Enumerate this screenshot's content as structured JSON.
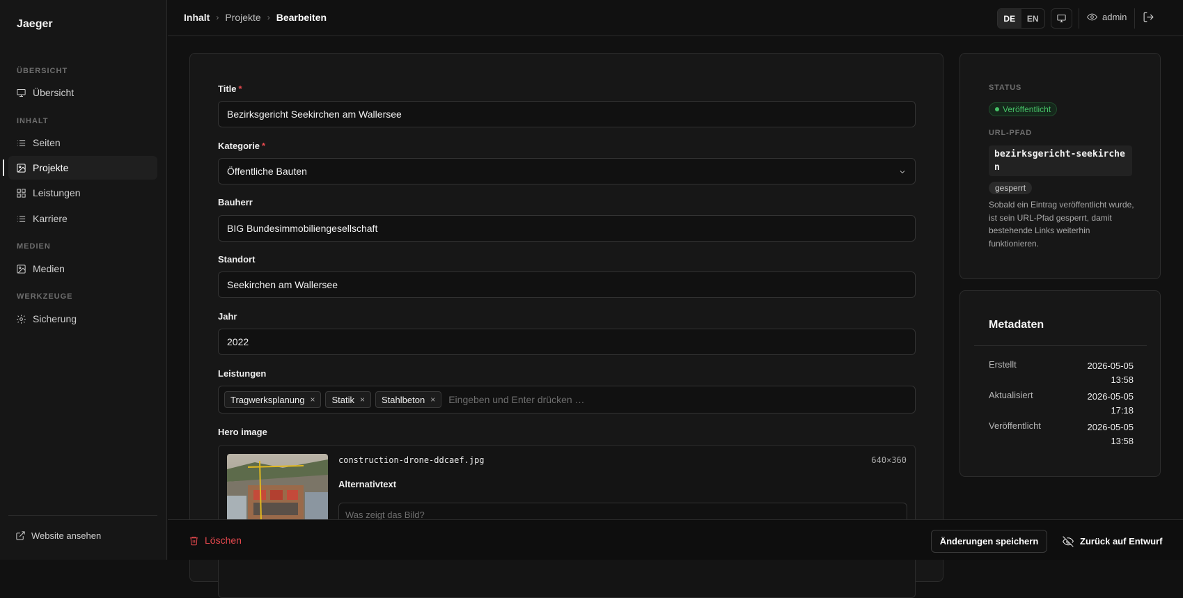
{
  "app": {
    "brand": "Jaeger"
  },
  "sidebar": {
    "sections": [
      {
        "title": "ÜBERSICHT"
      },
      {
        "title": "INHALT"
      },
      {
        "title": "MEDIEN"
      },
      {
        "title": "WERKZEUGE"
      }
    ],
    "items": [
      {
        "label": "Übersicht",
        "icon": "monitor-icon"
      },
      {
        "label": "Seiten",
        "icon": "list-icon"
      },
      {
        "label": "Projekte",
        "icon": "image-icon",
        "active": true
      },
      {
        "label": "Leistungen",
        "icon": "grid-icon"
      },
      {
        "label": "Karriere",
        "icon": "list-icon"
      },
      {
        "label": "Medien",
        "icon": "image-icon"
      },
      {
        "label": "Sicherung",
        "icon": "gear-icon"
      }
    ],
    "external_link": "Website ansehen"
  },
  "topbar": {
    "breadcrumb": [
      "Inhalt",
      "Projekte",
      "Bearbeiten"
    ],
    "lang": [
      "DE",
      "EN"
    ],
    "active_lang": "DE",
    "user": "admin"
  },
  "form": {
    "title": {
      "label": "Title",
      "required": "*",
      "value": "Bezirksgericht Seekirchen am Wallersee"
    },
    "kategorie": {
      "label": "Kategorie",
      "required": "*",
      "value": "Öffentliche Bauten"
    },
    "bauherr": {
      "label": "Bauherr",
      "value": "BIG Bundesimmobiliengesellschaft"
    },
    "standort": {
      "label": "Standort",
      "value": "Seekirchen am Wallersee"
    },
    "jahr": {
      "label": "Jahr",
      "value": "2022"
    },
    "leistungen": {
      "label": "Leistungen",
      "tags": [
        "Tragwerksplanung",
        "Statik",
        "Stahlbeton"
      ],
      "remove_glyph": "×",
      "placeholder": "Eingeben und Enter drücken …"
    },
    "hero": {
      "label": "Hero image",
      "filename": "construction-drone-ddcaef.jpg",
      "dimensions": "640×360",
      "alt_label": "Alternativtext",
      "alt_placeholder": "Was zeigt das Bild?"
    }
  },
  "status": {
    "label": "STATUS",
    "value": "Veröffentlicht",
    "url_label": "URL-PFAD",
    "slug": "bezirksgericht-seekirchen",
    "locked": "gesperrt",
    "help": "Sobald ein Eintrag veröffentlicht wurde, ist sein URL-Pfad gesperrt, damit bestehende Links weiterhin funktionieren."
  },
  "metadata": {
    "title": "Metadaten",
    "rows": [
      {
        "key": "Erstellt",
        "date": "2026-05-05",
        "time": "13:58"
      },
      {
        "key": "Aktualisiert",
        "date": "2026-05-05",
        "time": "17:18"
      },
      {
        "key": "Veröffentlicht",
        "date": "2026-05-05",
        "time": "13:58"
      }
    ]
  },
  "footer": {
    "delete": "Löschen",
    "save": "Änderungen speichern",
    "draft": "Zurück auf Entwurf"
  },
  "colors": {
    "accent_danger": "#e5484d",
    "status_green": "#46c267",
    "background": "#111111"
  }
}
